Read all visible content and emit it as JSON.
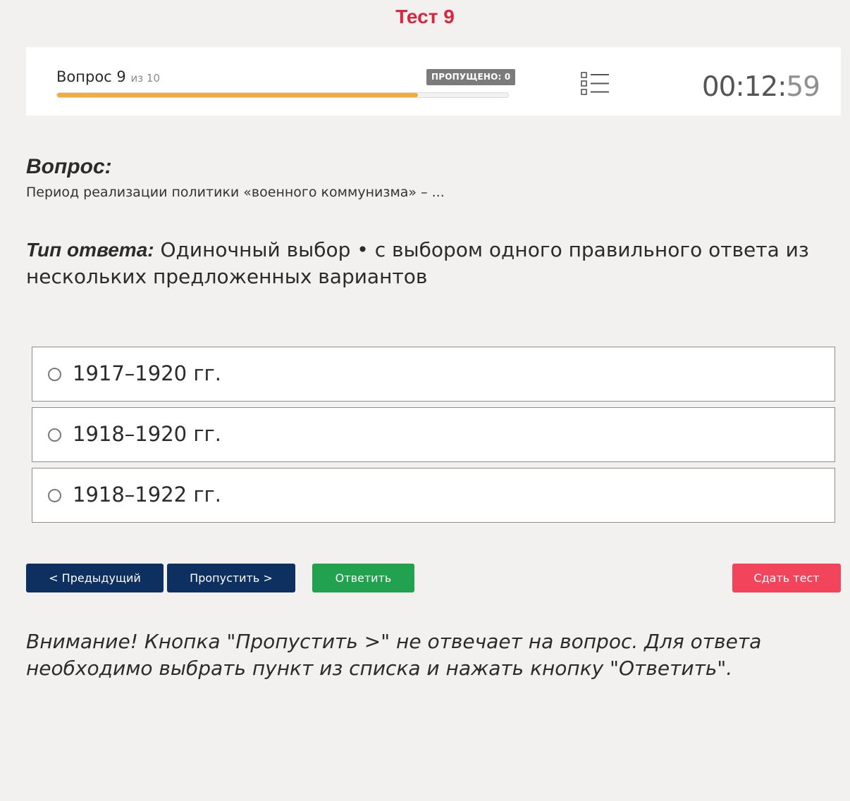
{
  "page": {
    "title": "Тест 9"
  },
  "header": {
    "question_label": "Вопрос 9",
    "question_of": "из 10",
    "skipped_badge": "ПРОПУЩЕНО: 0",
    "progress_percent": 80,
    "list_icon": "list-icon",
    "timer_main": "00:12:",
    "timer_seconds": "59"
  },
  "question": {
    "heading": "Вопрос:",
    "text": "Период реализации политики «военного коммунизма» – ..."
  },
  "answer_type": {
    "label": "Тип ответа:",
    "value": " Одиночный выбор • с выбором одного правильного ответа из нескольких предложенных вариантов"
  },
  "options": [
    {
      "label": "1917–1920 гг."
    },
    {
      "label": "1918–1920 гг."
    },
    {
      "label": "1918–1922 гг."
    }
  ],
  "buttons": {
    "prev": "< Предыдущий",
    "skip": "Пропустить >",
    "answer": "Ответить",
    "submit": "Сдать тест"
  },
  "warning": "Внимание! Кнопка \"Пропустить >\" не отвечает на вопрос. Для ответа необходимо выбрать пункт из списка и нажать кнопку \"Ответить\".",
  "colors": {
    "title": "#d8263e",
    "progress": "#f0ad3c",
    "nav_button": "#0d3061",
    "answer_button": "#22a14e",
    "submit_button": "#f2445a"
  }
}
